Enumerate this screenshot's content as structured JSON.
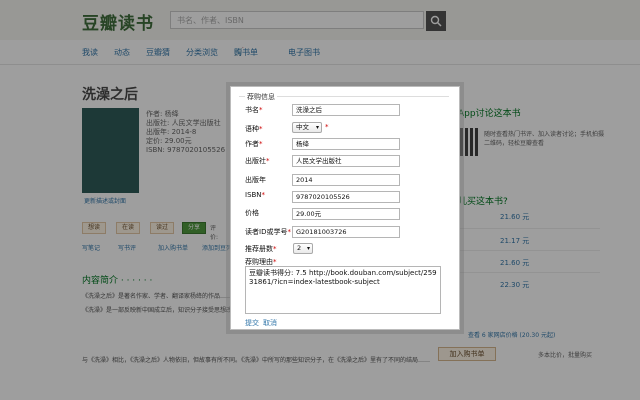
{
  "header": {
    "logo": "豆瓣读书",
    "search_placeholder": "书名、作者、ISBN"
  },
  "nav": [
    "我读",
    "动态",
    "豆瓣猜",
    "分类浏览",
    "购书单",
    "电子图书"
  ],
  "book": {
    "title": "洗澡之后",
    "cover_link": "更新描述或封面",
    "meta": [
      "作者: 杨绛",
      "出版社: 人民文学出版社",
      "出版年: 2014-8",
      "定价: 29.00元",
      "ISBN: 9787020105526"
    ]
  },
  "actions": {
    "want": "想读",
    "reading": "在读",
    "read": "读过",
    "share": "分享",
    "rating_label": "评价:"
  },
  "small_links": [
    "写笔记",
    "写书评",
    "加入购书单",
    "添加到豆列"
  ],
  "intro": {
    "heading": "内容简介 · · · · · ·",
    "p1": "《洗澡之后》是著名作家、学者、翻译家杨绛的作品……",
    "p2": "《洗澡》是一部反映新中国成立后，知识分子接受思想改造的长篇小说……",
    "p3": "与《洗澡》相比，《洗澡之后》人物依旧，但故事有所不同。《洗澡》中所写的那些知识分子，在《洗澡之后》里有了不同的结局……"
  },
  "sidebar": {
    "app_title": "豆瓣App讨论这本书",
    "app_desc": "随时查看热门书评、加入读者讨论；手机拍摄二维码，轻松豆瓣查看",
    "buy_title": "在哪儿买这本书?",
    "prices": [
      "21.60 元",
      "21.17 元",
      "21.60 元",
      "22.30 元"
    ],
    "footer_link": "查看 6 家网店价格 (20.30 元起)",
    "buy_button": "加入购书单",
    "buy_note": "多本比价，批量购买"
  },
  "dialog": {
    "legend": "荐购信息",
    "title_label": "书名",
    "title_value": "洗澡之后",
    "language_label": "语种",
    "language_value": "中文",
    "author_label": "作者",
    "author_value": "杨绛",
    "publisher_label": "出版社",
    "publisher_value": "人民文学出版社",
    "year_label": "出版年",
    "year_value": "2014",
    "isbn_label": "ISBN",
    "isbn_value": "9787020105526",
    "price_label": "价格",
    "price_value": "29.00元",
    "reader_id_label": "读者ID或学号",
    "reader_id_value": "G20181003726",
    "count_label": "推荐册数",
    "count_value": "2",
    "reason_label": "荐购理由",
    "reason_value": "豆瓣读书得分: 7.5 http://book.douban.com/subject/25931861/?icn=index-latestbook-subject",
    "required_mark": "*",
    "submit_label": "提交",
    "cancel_label": "取消"
  }
}
